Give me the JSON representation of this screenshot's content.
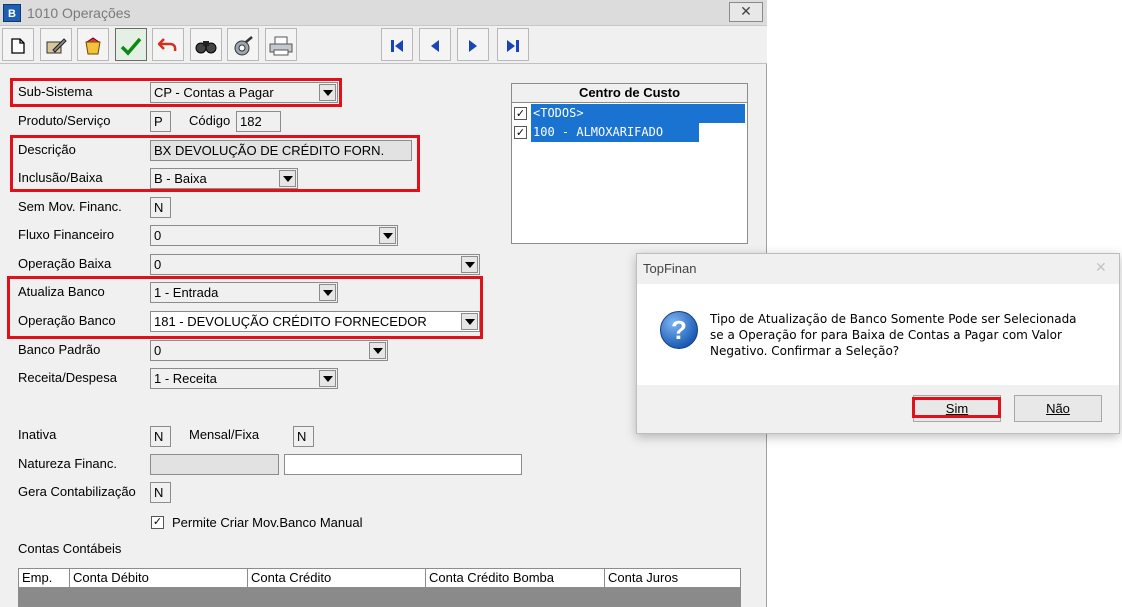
{
  "window": {
    "icon_text": "B",
    "title": "1010 Operações",
    "close_glyph": "✕"
  },
  "toolbar": {
    "buttons": [
      "new-document-icon",
      "edit-icon",
      "delete-icon",
      "confirm-icon",
      "undo-icon",
      "find-icon",
      "tool-icon",
      "print-icon"
    ],
    "nav": [
      "first-record-icon",
      "previous-record-icon",
      "next-record-icon",
      "last-record-icon"
    ]
  },
  "form": {
    "sub_sistema": {
      "label": "Sub-Sistema",
      "value": "CP - Contas a Pagar"
    },
    "produto_servico": {
      "label": "Produto/Serviço",
      "value": "P"
    },
    "codigo": {
      "label": "Código",
      "value": "182"
    },
    "descricao": {
      "label": "Descrição",
      "value": "BX DEVOLUÇÃO DE CRÉDITO FORN."
    },
    "inclusao_baixa": {
      "label": "Inclusão/Baixa",
      "value": "B - Baixa"
    },
    "sem_mov_financ": {
      "label": "Sem Mov. Financ.",
      "value": "N"
    },
    "fluxo_financeiro": {
      "label": "Fluxo Financeiro",
      "value": "0"
    },
    "operacao_baixa": {
      "label": "Operação Baixa",
      "value": "0"
    },
    "atualiza_banco": {
      "label": "Atualiza Banco",
      "value": "1 - Entrada"
    },
    "operacao_banco": {
      "label": "Operação Banco",
      "value": "181 - DEVOLUÇÃO CRÉDITO FORNECEDOR"
    },
    "banco_padrao": {
      "label": "Banco Padrão",
      "value": "0"
    },
    "receita_despesa": {
      "label": "Receita/Despesa",
      "value": "1 - Receita"
    },
    "inativa": {
      "label": "Inativa",
      "value": "N"
    },
    "mensal_fixa": {
      "label": "Mensal/Fixa",
      "value": "N"
    },
    "natureza_financ": {
      "label": "Natureza Financ.",
      "value": "",
      "value2": ""
    },
    "gera_contabilizacao": {
      "label": "Gera Contabilização",
      "value": "N"
    },
    "permite_criar": {
      "label": "Permite Criar Mov.Banco Manual",
      "checked": true
    },
    "contas_contabeis": {
      "label": "Contas Contábeis"
    }
  },
  "centro_custo": {
    "title": "Centro de Custo",
    "items": [
      {
        "label": "<TODOS>",
        "checked": true
      },
      {
        "label": "100 - ALMOXARIFADO",
        "checked": true
      }
    ]
  },
  "grid": {
    "columns": [
      "Emp.",
      "Conta Débito",
      "Conta Crédito",
      "Conta Crédito Bomba",
      "Conta Juros"
    ]
  },
  "dialog": {
    "title": "TopFinan",
    "close_glyph": "✕",
    "icon": "question-icon",
    "icon_glyph": "?",
    "message_lines": [
      "Tipo de Atualização de Banco Somente Pode ser Selecionada",
      "se a Operação for para Baixa de Contas a Pagar com Valor",
      "Negativo. Confirmar a Seleção?"
    ],
    "yes_label": "Sim",
    "no_label": "Não"
  },
  "colors": {
    "highlight_box": "#e0111a",
    "selection": "#1a73d1"
  }
}
